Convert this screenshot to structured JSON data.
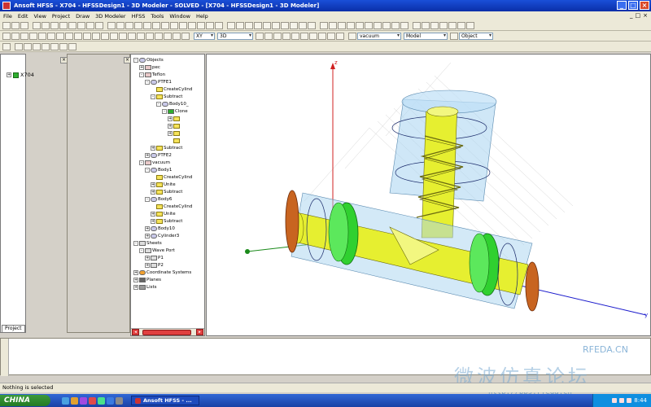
{
  "window": {
    "title": "Ansoft HFSS - X704 - HFSSDesign1 - 3D Modeler - SOLVED - [X704 - HFSSDesign1 - 3D Modeler]",
    "controls": [
      "_",
      "□",
      "×"
    ]
  },
  "menu": [
    "File",
    "Edit",
    "View",
    "Project",
    "Draw",
    "3D Modeler",
    "HFSS",
    "Tools",
    "Window",
    "Help"
  ],
  "toolbar": {
    "plane_select": "XY",
    "dim_select": "3D",
    "material_select": "vacuum",
    "model_select": "Model",
    "snap_select": "Object"
  },
  "project": {
    "root": "X704",
    "tab": "Project"
  },
  "tree": [
    {
      "label": "Objects",
      "icon": "obj",
      "level": 0,
      "expand": "-"
    },
    {
      "label": "pec",
      "icon": "mat",
      "level": 1,
      "expand": "+"
    },
    {
      "label": "Teflon",
      "icon": "mat",
      "level": 1,
      "expand": "-"
    },
    {
      "label": "PTFE1",
      "icon": "obj",
      "level": 2,
      "expand": "-"
    },
    {
      "label": "CreateCylind",
      "icon": "cmd",
      "level": 3,
      "expand": ""
    },
    {
      "label": "Subtract",
      "icon": "cmd",
      "level": 3,
      "expand": "-"
    },
    {
      "label": "Body10_",
      "icon": "obj",
      "level": 4,
      "expand": "-"
    },
    {
      "label": "Clone",
      "icon": "green",
      "level": 5,
      "expand": "-"
    },
    {
      "label": "",
      "icon": "cmd",
      "level": 6,
      "expand": "+"
    },
    {
      "label": "",
      "icon": "cmd",
      "level": 6,
      "expand": "+"
    },
    {
      "label": "",
      "icon": "cmd",
      "level": 6,
      "expand": "+"
    },
    {
      "label": "",
      "icon": "cmd",
      "level": 6,
      "expand": ""
    },
    {
      "label": "Subtract",
      "icon": "cmd",
      "level": 3,
      "expand": "+"
    },
    {
      "label": "PTFE2",
      "icon": "obj",
      "level": 2,
      "expand": "+"
    },
    {
      "label": "vacuum",
      "icon": "mat",
      "level": 1,
      "expand": "-"
    },
    {
      "label": "Body1",
      "icon": "obj",
      "level": 2,
      "expand": "-"
    },
    {
      "label": "CreateCylind",
      "icon": "cmd",
      "level": 3,
      "expand": ""
    },
    {
      "label": "Unite",
      "icon": "cmd",
      "level": 3,
      "expand": "+"
    },
    {
      "label": "Subtract",
      "icon": "cmd",
      "level": 3,
      "expand": "+"
    },
    {
      "label": "Body6",
      "icon": "obj",
      "level": 2,
      "expand": "-"
    },
    {
      "label": "CreateCylind",
      "icon": "cmd",
      "level": 3,
      "expand": ""
    },
    {
      "label": "Unite",
      "icon": "cmd",
      "level": 3,
      "expand": "+"
    },
    {
      "label": "Subtract",
      "icon": "cmd",
      "level": 3,
      "expand": "+"
    },
    {
      "label": "Body10",
      "icon": "obj",
      "level": 2,
      "expand": "+"
    },
    {
      "label": "Cylinder3",
      "icon": "obj",
      "level": 2,
      "expand": "+"
    },
    {
      "label": "Sheets",
      "icon": "sheet",
      "level": 0,
      "expand": "-"
    },
    {
      "label": "Wave Port",
      "icon": "sheet",
      "level": 1,
      "expand": "-"
    },
    {
      "label": "P1",
      "icon": "sheet",
      "level": 2,
      "expand": "+"
    },
    {
      "label": "P2",
      "icon": "sheet",
      "level": 2,
      "expand": "+"
    },
    {
      "label": "Coordinate Systems",
      "icon": "cs",
      "level": 0,
      "expand": "+"
    },
    {
      "label": "Planes",
      "icon": "plane",
      "level": 0,
      "expand": "+"
    },
    {
      "label": "Lists",
      "icon": "list",
      "level": 0,
      "expand": "+"
    }
  ],
  "viewport": {
    "axis_z": "z",
    "axis_y": "y",
    "colors": {
      "z_axis": "#d02020",
      "x_axis": "#1a1acc",
      "y_axis": "#1a8a1a",
      "conductor": "#e6ef30",
      "teflon": "#30d030",
      "vacuum": "#a8d4f0"
    }
  },
  "status": "Nothing is selected",
  "watermark": {
    "chinese": "微波仿真论坛",
    "site": "RFEDA.CN",
    "url": "http://bbs.rfeda.cn"
  },
  "taskbar": {
    "start": "CHINA",
    "task": "Ansoft HFSS - ...",
    "time": "8:44"
  }
}
